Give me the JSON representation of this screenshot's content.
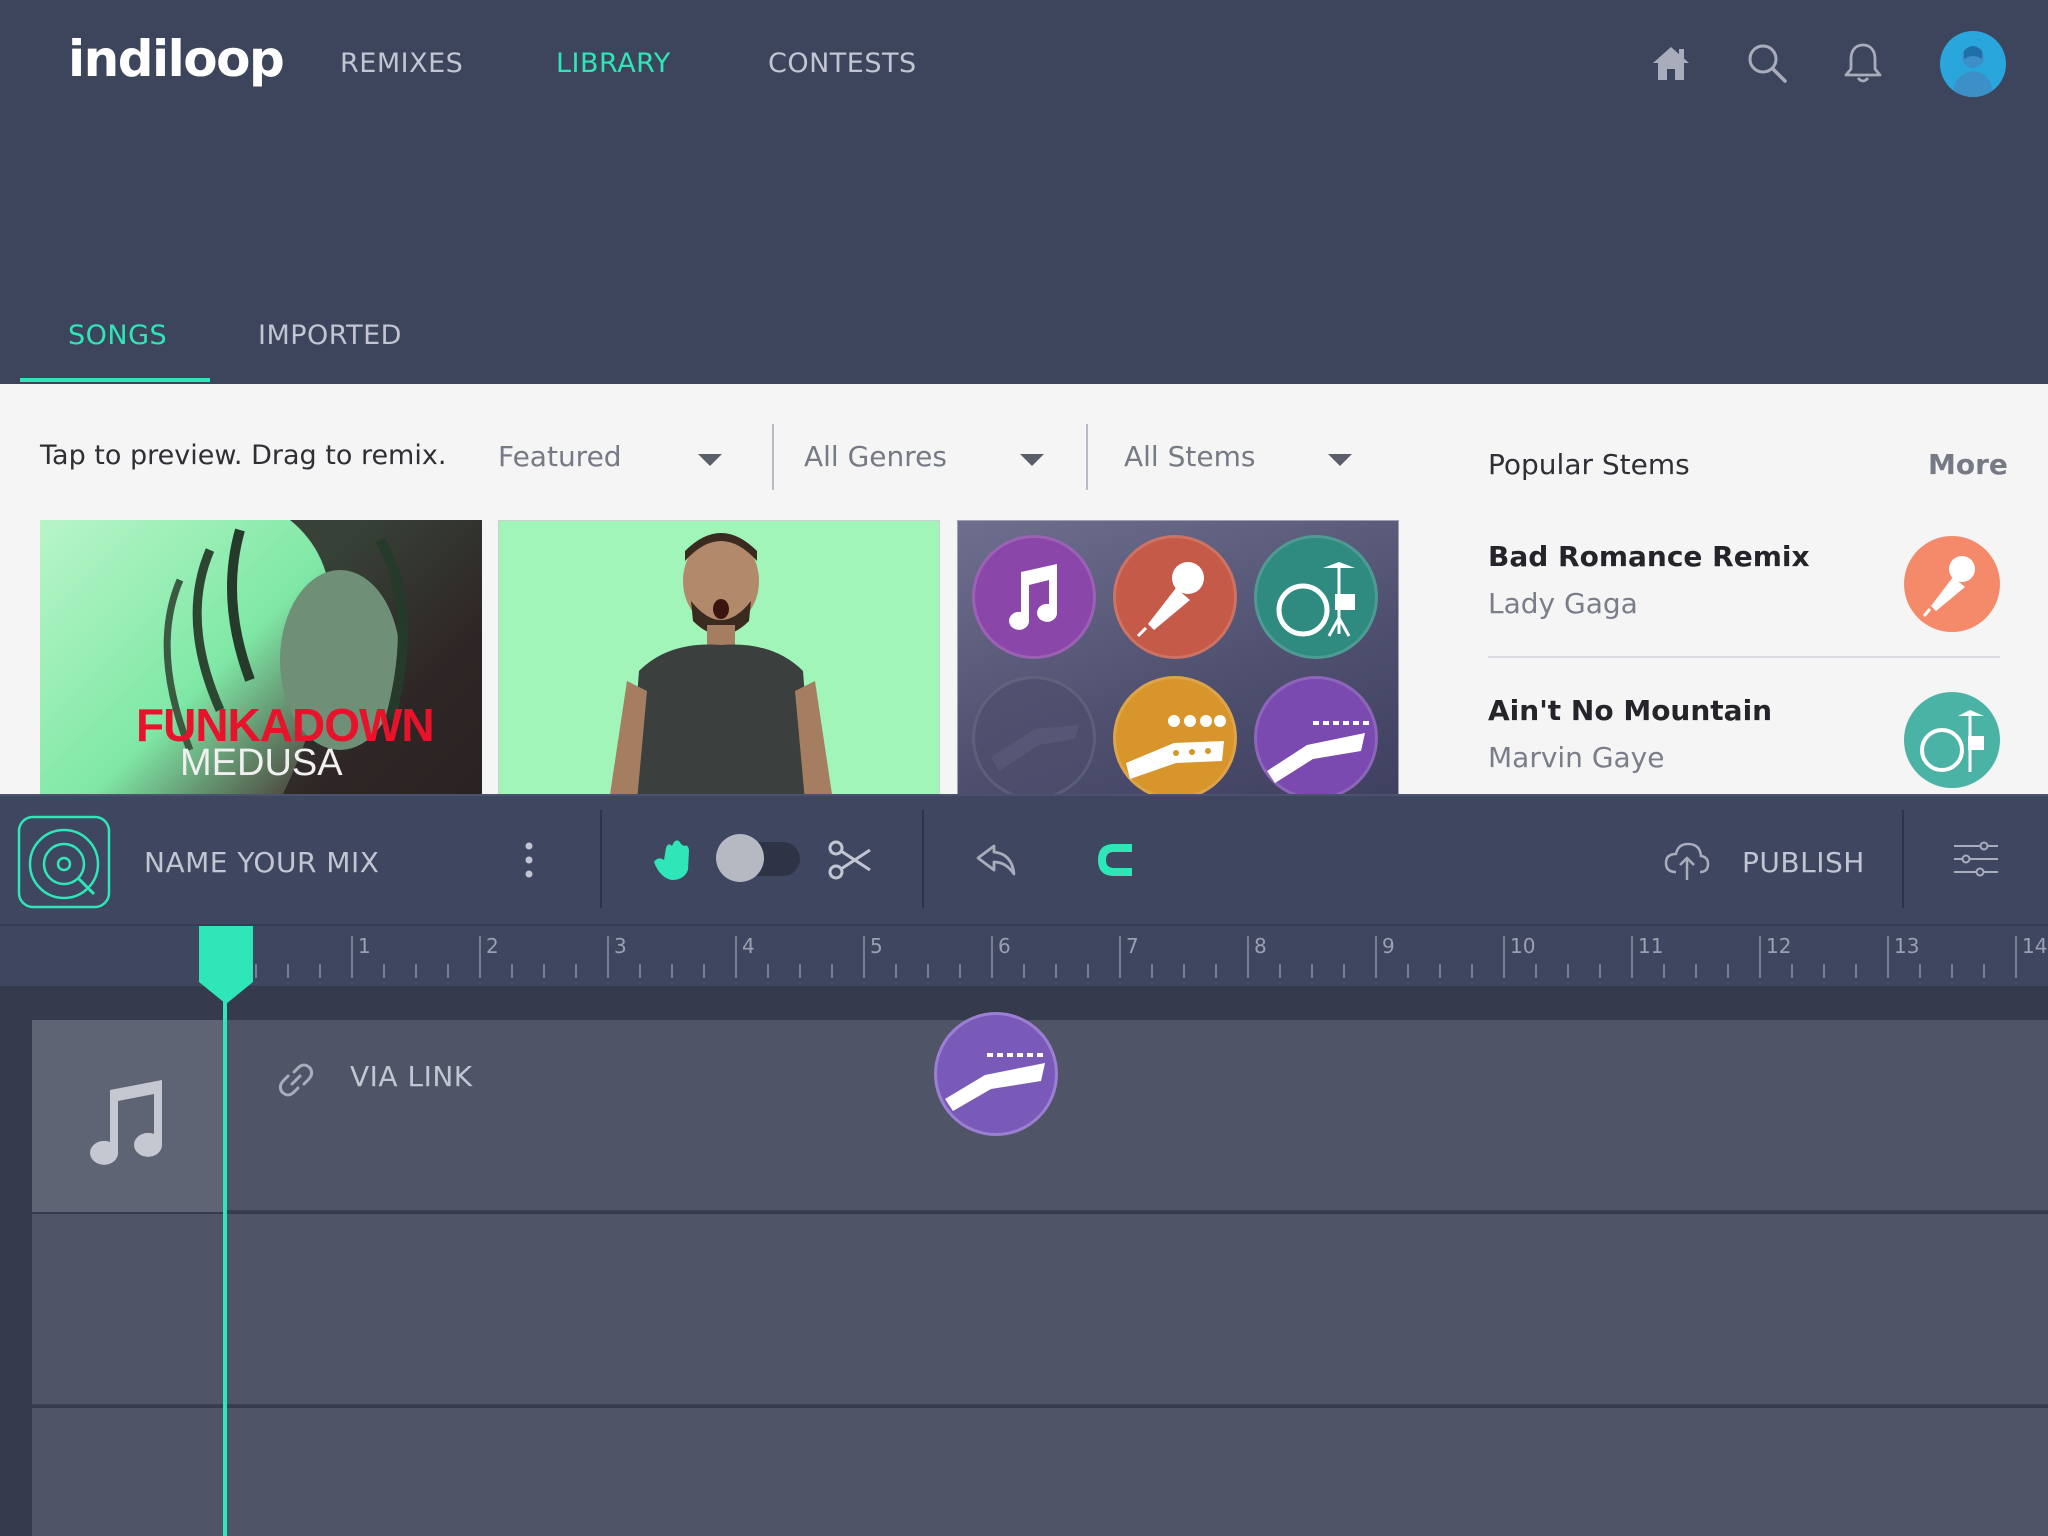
{
  "app": {
    "logo": "indiloop",
    "nav": {
      "remixes": "REMIXES",
      "library": "LIBRARY",
      "contests": "CONTESTS"
    },
    "accent": "#2ee6b7"
  },
  "library": {
    "tabs": {
      "songs": "SONGS",
      "imported": "IMPORTED"
    },
    "hint": "Tap to preview. Drag to remix.",
    "filters": {
      "sort": "Featured",
      "genre": "All Genres",
      "stems": "All Stems"
    },
    "tiles": [
      {
        "title": "FUNKADOWN",
        "subtitle": "MEDUSA"
      }
    ],
    "popular": {
      "title": "Popular Stems",
      "more": "More",
      "items": [
        {
          "song": "Bad Romance Remix",
          "artist": "Lady Gaga",
          "stem": "microphone-icon",
          "color": "#f48a6a"
        },
        {
          "song": "Ain't No Mountain",
          "artist": "Marvin Gaye",
          "stem": "drums-icon",
          "color": "#4bb3a5"
        }
      ]
    }
  },
  "mixer": {
    "name_placeholder": "NAME YOUR MIX",
    "publish": "PUBLISH",
    "ruler": [
      "1",
      "2",
      "3",
      "4",
      "5",
      "6",
      "7",
      "8",
      "9",
      "10",
      "11",
      "12",
      "13",
      "14"
    ],
    "tracks": [
      {
        "label": "VIA LINK"
      }
    ]
  }
}
